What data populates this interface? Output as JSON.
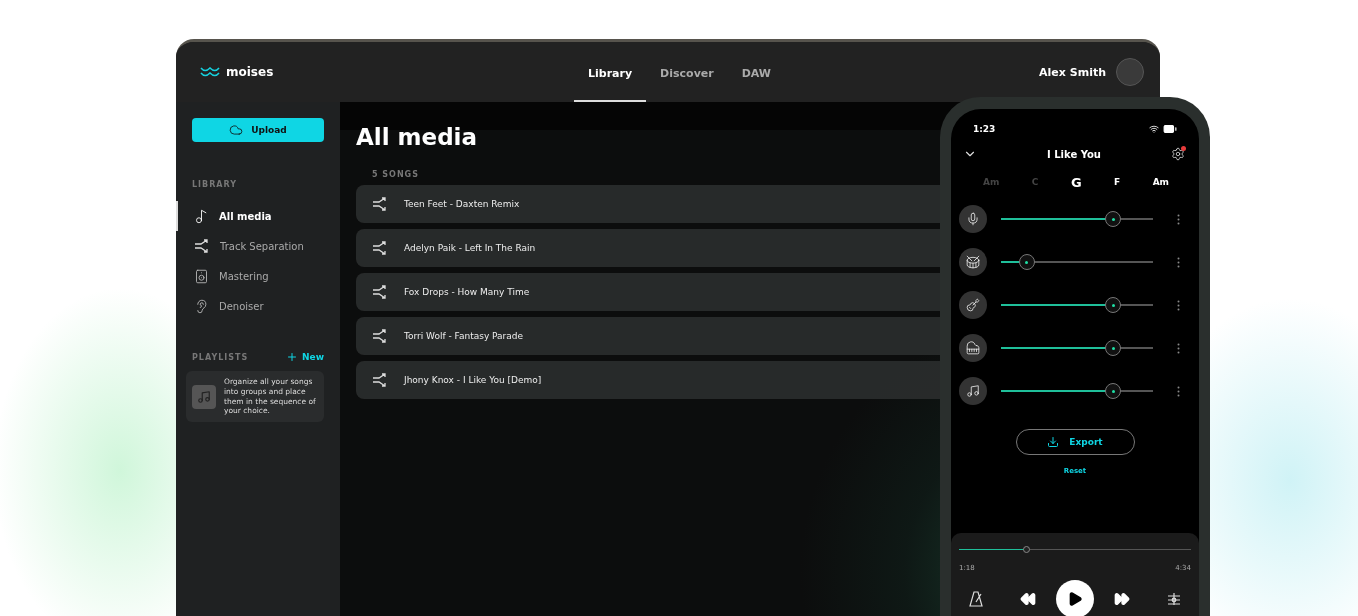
{
  "app": {
    "logo": "moises",
    "tabs": [
      {
        "label": "Library",
        "selected": true
      },
      {
        "label": "Discover",
        "selected": false
      },
      {
        "label": "DAW",
        "selected": false
      }
    ],
    "user": {
      "name": "Alex Smith"
    }
  },
  "sidebar": {
    "upload_button": "Upload",
    "library_heading": "LIBRARY",
    "items": [
      {
        "label": "All media",
        "kind": "media",
        "selected": true
      },
      {
        "label": "Track Separation",
        "kind": "separation",
        "selected": false
      },
      {
        "label": "Mastering",
        "kind": "mastering",
        "selected": false
      },
      {
        "label": "Denoiser",
        "kind": "denoiser",
        "selected": false
      }
    ],
    "playlists_heading": "PLAYLISTS",
    "new_button": "New",
    "playlist_hint": "Organize all your songs into groups and place them in the sequence of your choice."
  },
  "main": {
    "title": "All media",
    "count": "5 SONGS",
    "songs": [
      {
        "title": "Teen Feet - Daxten Remix"
      },
      {
        "title": "Adelyn Paik - Left In The Rain"
      },
      {
        "title": "Fox Drops - How Many Time"
      },
      {
        "title": "Torri Wolf - Fantasy Parade"
      },
      {
        "title": "Jhony Knox - I Like You [Demo]"
      }
    ]
  },
  "phone": {
    "time": "1:23",
    "song_title": "I Like You",
    "chords": [
      {
        "label": "Am",
        "selected": false,
        "past": true
      },
      {
        "label": "C",
        "selected": false,
        "past": true
      },
      {
        "label": "G",
        "selected": true,
        "past": false
      },
      {
        "label": "F",
        "selected": false,
        "past": false
      },
      {
        "label": "Am",
        "selected": false,
        "past": false
      }
    ],
    "stems": [
      {
        "kind": "vocals",
        "level": 0.74
      },
      {
        "kind": "drums",
        "level": 0.17
      },
      {
        "kind": "guitar",
        "level": 0.74
      },
      {
        "kind": "piano",
        "level": 0.74
      },
      {
        "kind": "other",
        "level": 0.74
      }
    ],
    "export_button": "Export",
    "reset_link": "Reset",
    "player": {
      "level": 0.29,
      "elapsed": "1:18",
      "total": "4:34"
    }
  }
}
